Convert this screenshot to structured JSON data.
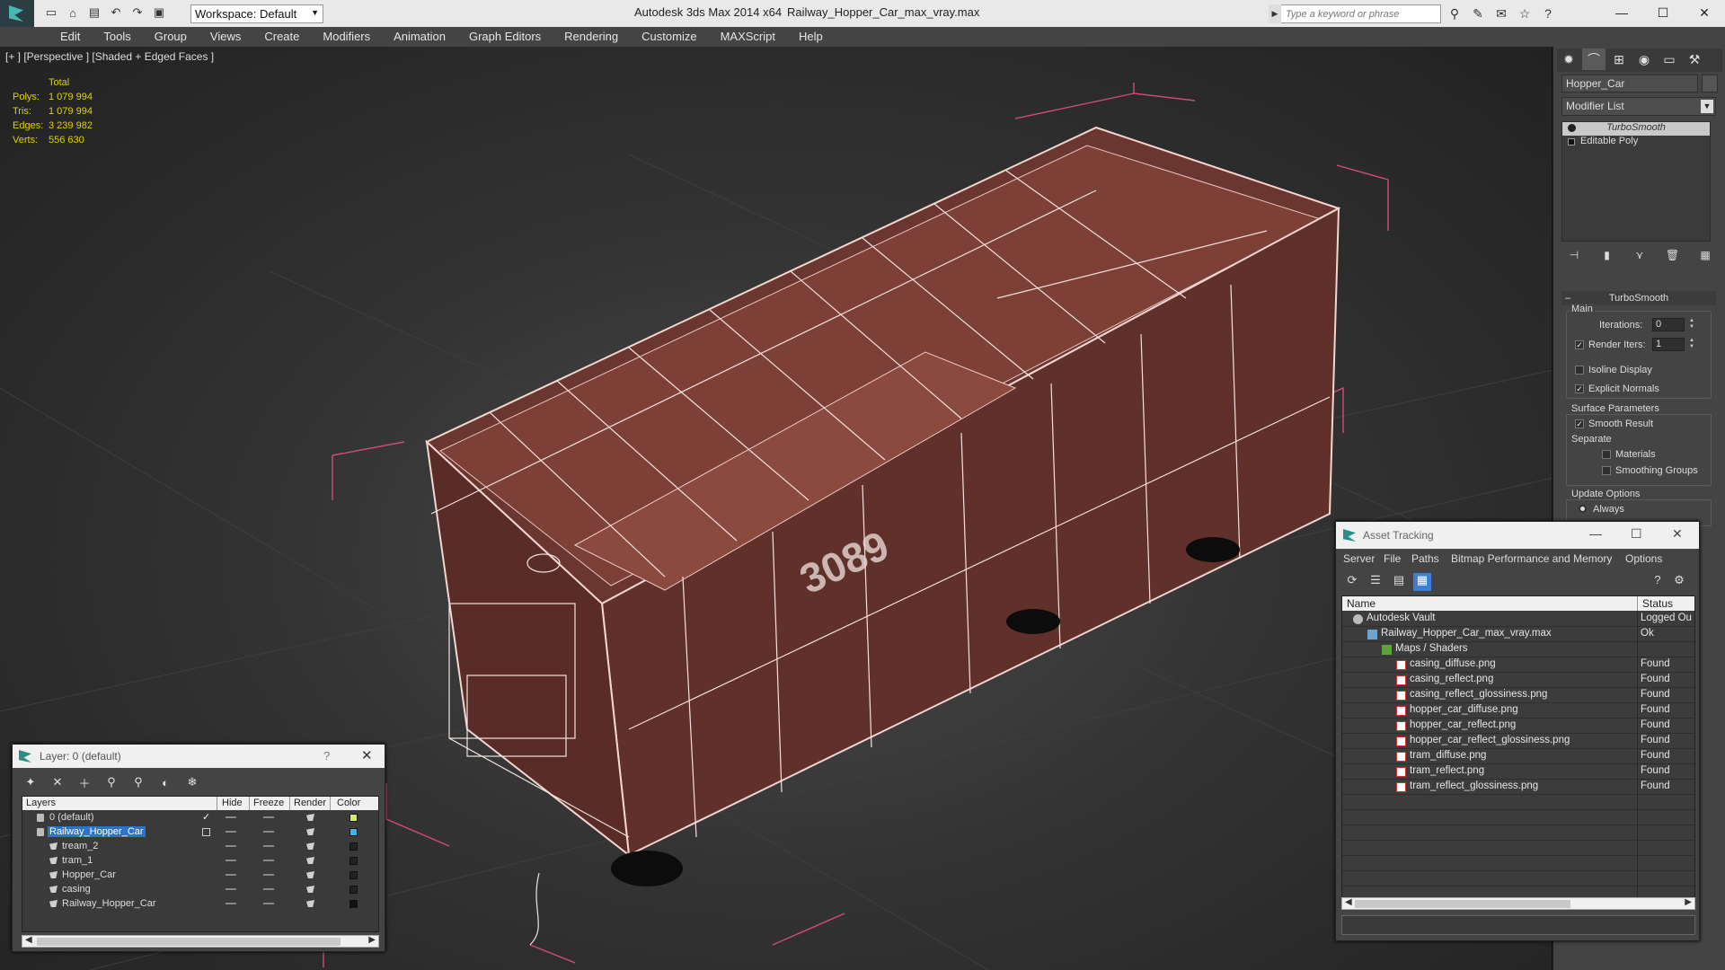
{
  "titlebar": {
    "workspace": "Workspace: Default",
    "app_title": "Autodesk 3ds Max  2014 x64",
    "file_name": "Railway_Hopper_Car_max_vray.max",
    "search_placeholder": "Type a keyword or phrase"
  },
  "menu": [
    "Edit",
    "Tools",
    "Group",
    "Views",
    "Create",
    "Modifiers",
    "Animation",
    "Graph Editors",
    "Rendering",
    "Customize",
    "MAXScript",
    "Help"
  ],
  "viewport": {
    "label": "[+ ] [Perspective ] [Shaded + Edged Faces ]",
    "stats_header": "Total",
    "stats": [
      {
        "key": "Polys:",
        "value": "1 079 994"
      },
      {
        "key": "Tris:",
        "value": "1 079 994"
      },
      {
        "key": "Edges:",
        "value": "3 239 982"
      },
      {
        "key": "Verts:",
        "value": "556 630"
      }
    ]
  },
  "command_panel": {
    "object_name": "Hopper_Car",
    "modifier_list": "Modifier List",
    "stack": [
      "TurboSmooth",
      "Editable Poly"
    ],
    "rollout_title": "TurboSmooth",
    "main_group": "Main",
    "iterations_label": "Iterations:",
    "iterations_value": "0",
    "render_iters_label": "Render Iters:",
    "render_iters_value": "1",
    "render_iters_checked": true,
    "isoline_label": "Isoline Display",
    "isoline_checked": false,
    "explicit_normals_label": "Explicit Normals",
    "explicit_normals_checked": true,
    "surface_group": "Surface Parameters",
    "smooth_result_label": "Smooth Result",
    "smooth_result_checked": true,
    "separate_label": "Separate",
    "materials_label": "Materials",
    "smoothing_groups_label": "Smoothing Groups",
    "update_group": "Update Options",
    "always_label": "Always"
  },
  "layer_dialog": {
    "title": "Layer: 0 (default)",
    "help": "?",
    "columns": [
      "Layers",
      "Hide",
      "Freeze",
      "Render",
      "Color"
    ],
    "rows": [
      {
        "name": "0 (default)",
        "indent": 0,
        "color": "#d6e87c",
        "selected": false,
        "current": true,
        "kind": "layer"
      },
      {
        "name": "Railway_Hopper_Car",
        "indent": 0,
        "color": "#47b0e0",
        "selected": true,
        "current": false,
        "kind": "layer"
      },
      {
        "name": "tream_2",
        "indent": 1,
        "color": "#222222",
        "selected": false,
        "current": false,
        "kind": "object"
      },
      {
        "name": "tram_1",
        "indent": 1,
        "color": "#222222",
        "selected": false,
        "current": false,
        "kind": "object"
      },
      {
        "name": "Hopper_Car",
        "indent": 1,
        "color": "#222222",
        "selected": false,
        "current": false,
        "kind": "object"
      },
      {
        "name": "casing",
        "indent": 1,
        "color": "#222222",
        "selected": false,
        "current": false,
        "kind": "object"
      },
      {
        "name": "Railway_Hopper_Car",
        "indent": 1,
        "color": "#111111",
        "selected": false,
        "current": false,
        "kind": "object"
      }
    ]
  },
  "asset_tracking": {
    "title": "Asset Tracking",
    "menu": [
      "Server",
      "File",
      "Paths",
      "Bitmap Performance and Memory",
      "Options"
    ],
    "columns": [
      "Name",
      "Status"
    ],
    "rows": [
      {
        "name": "Autodesk Vault",
        "status": "Logged Ou",
        "indent": 0,
        "icon": "vault"
      },
      {
        "name": "Railway_Hopper_Car_max_vray.max",
        "status": "Ok",
        "indent": 1,
        "icon": "max"
      },
      {
        "name": "Maps / Shaders",
        "status": "",
        "indent": 2,
        "icon": "folder"
      },
      {
        "name": "casing_diffuse.png",
        "status": "Found",
        "indent": 3,
        "icon": "png"
      },
      {
        "name": "casing_reflect.png",
        "status": "Found",
        "indent": 3,
        "icon": "png"
      },
      {
        "name": "casing_reflect_glossiness.png",
        "status": "Found",
        "indent": 3,
        "icon": "png"
      },
      {
        "name": "hopper_car_diffuse.png",
        "status": "Found",
        "indent": 3,
        "icon": "png"
      },
      {
        "name": "hopper_car_reflect.png",
        "status": "Found",
        "indent": 3,
        "icon": "png"
      },
      {
        "name": "hopper_car_reflect_glossiness.png",
        "status": "Found",
        "indent": 3,
        "icon": "png"
      },
      {
        "name": "tram_diffuse.png",
        "status": "Found",
        "indent": 3,
        "icon": "png"
      },
      {
        "name": "tram_reflect.png",
        "status": "Found",
        "indent": 3,
        "icon": "png"
      },
      {
        "name": "tram_reflect_glossiness.png",
        "status": "Found",
        "indent": 3,
        "icon": "png"
      }
    ]
  }
}
